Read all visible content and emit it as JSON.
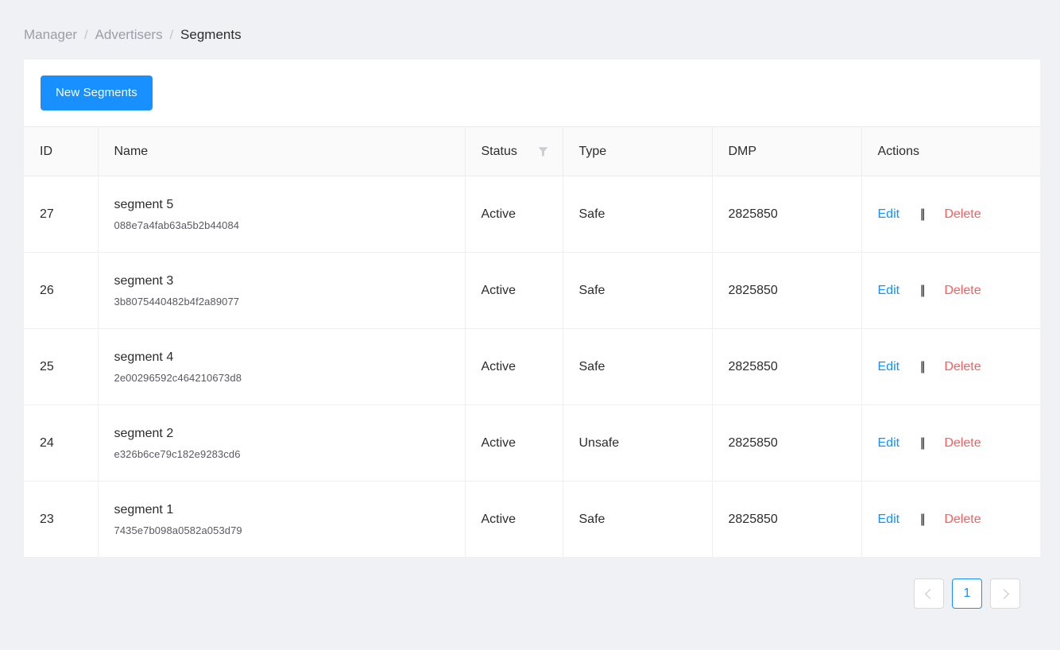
{
  "breadcrumb": {
    "separator": "/",
    "items": [
      {
        "label": "Manager",
        "current": false
      },
      {
        "label": "Advertisers",
        "current": false
      },
      {
        "label": "Segments",
        "current": true
      }
    ]
  },
  "toolbar": {
    "new_segments_label": "New Segments",
    "primary_color": "#1890ff"
  },
  "table": {
    "columns": [
      {
        "key": "id",
        "label": "ID",
        "filter": false
      },
      {
        "key": "name",
        "label": "Name",
        "filter": false
      },
      {
        "key": "status",
        "label": "Status",
        "filter": true,
        "filter_icon": "filter-funnel-icon"
      },
      {
        "key": "type",
        "label": "Type",
        "filter": false
      },
      {
        "key": "dmp",
        "label": "DMP",
        "filter": false
      },
      {
        "key": "actions",
        "label": "Actions",
        "filter": false
      }
    ],
    "rows": [
      {
        "id": "27",
        "name": "segment 5",
        "hash": "088e7a4fab63a5b2b44084",
        "status": "Active",
        "type": "Safe",
        "dmp": "2825850"
      },
      {
        "id": "26",
        "name": "segment 3",
        "hash": "3b8075440482b4f2a89077",
        "status": "Active",
        "type": "Safe",
        "dmp": "2825850"
      },
      {
        "id": "25",
        "name": "segment 4",
        "hash": "2e00296592c464210673d8",
        "status": "Active",
        "type": "Safe",
        "dmp": "2825850"
      },
      {
        "id": "24",
        "name": "segment 2",
        "hash": "e326b6ce79c182e9283cd6",
        "status": "Active",
        "type": "Unsafe",
        "dmp": "2825850"
      },
      {
        "id": "23",
        "name": "segment 1",
        "hash": "7435e7b098a0582a053d79",
        "status": "Active",
        "type": "Safe",
        "dmp": "2825850"
      }
    ],
    "actions": {
      "edit_label": "Edit",
      "separator": "||",
      "delete_label": "Delete",
      "edit_color": "#1890ff",
      "delete_color": "#ff5d5d"
    }
  },
  "pagination": {
    "prev_icon": "chevron-left-icon",
    "next_icon": "chevron-right-icon",
    "pages": [
      {
        "label": "1",
        "active": true
      }
    ],
    "current_page": "1",
    "active_color": "#1890ff"
  }
}
